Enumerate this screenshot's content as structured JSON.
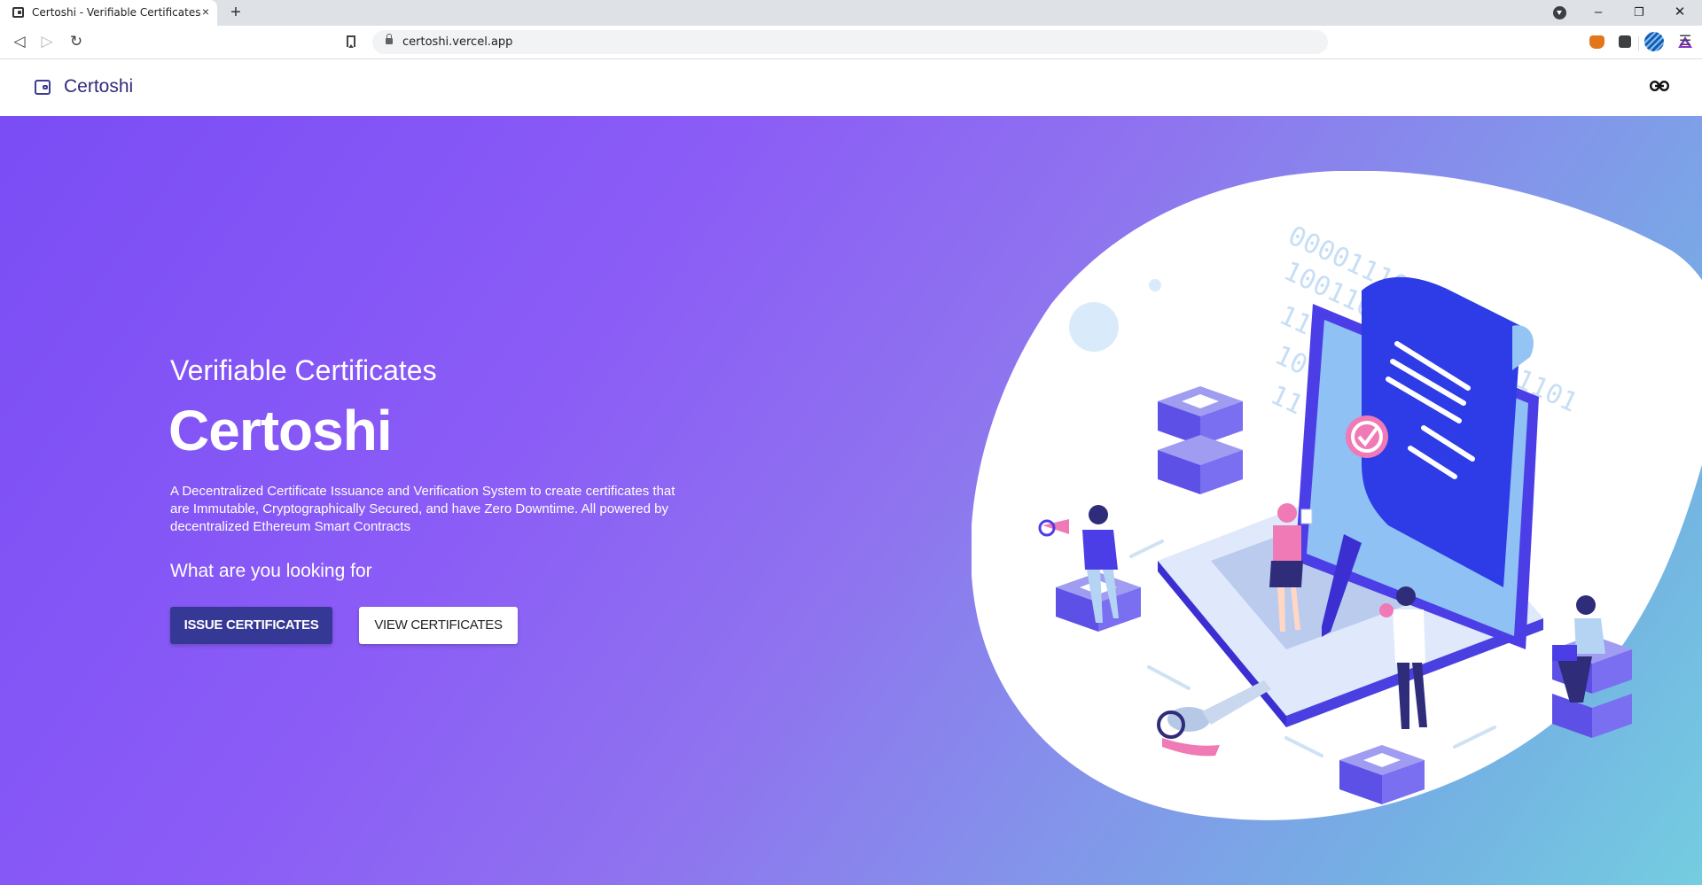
{
  "browser": {
    "tab_title": "Certoshi - Verifiable Certificates",
    "tab_close": "×",
    "new_tab": "+",
    "url": "certoshi.vercel.app",
    "window_controls": {
      "minimize": "–",
      "restore": "❐",
      "close": "✕"
    },
    "nav": {
      "back": "◁",
      "forward": "▷",
      "reload": "↻",
      "menu": "☰"
    },
    "icons": [
      "bookmark-icon",
      "lock-icon",
      "brave-shields-icon",
      "brave-rewards-icon",
      "metamask-extension-icon",
      "extensions-icon",
      "profile-globe-icon",
      "menu-icon"
    ]
  },
  "navbar": {
    "brand": "Certoshi",
    "icons": [
      "wallet-logo-icon",
      "link-icon"
    ]
  },
  "hero": {
    "subtitle": "Verifiable Certificates",
    "title": "Certoshi",
    "description": "A Decentralized Certificate Issuance and Verification System to create certificates that are Immutable, Cryptographically Secured, and have Zero Downtime. All powered by decentralized Ethereum Smart Contracts",
    "question": "What are you looking for",
    "issue_button": "ISSUE CERTIFICATES",
    "view_button": "VIEW CERTIFICATES"
  },
  "illustration": {
    "binary_lines": [
      "000011100001",
      "10011010110110001101",
      "11",
      "10",
      "11"
    ]
  },
  "colors": {
    "brand": "#2f2c7a",
    "primary_button": "#363895",
    "hero_gradient_start": "#7a4df5",
    "hero_gradient_end": "#74cde0"
  }
}
